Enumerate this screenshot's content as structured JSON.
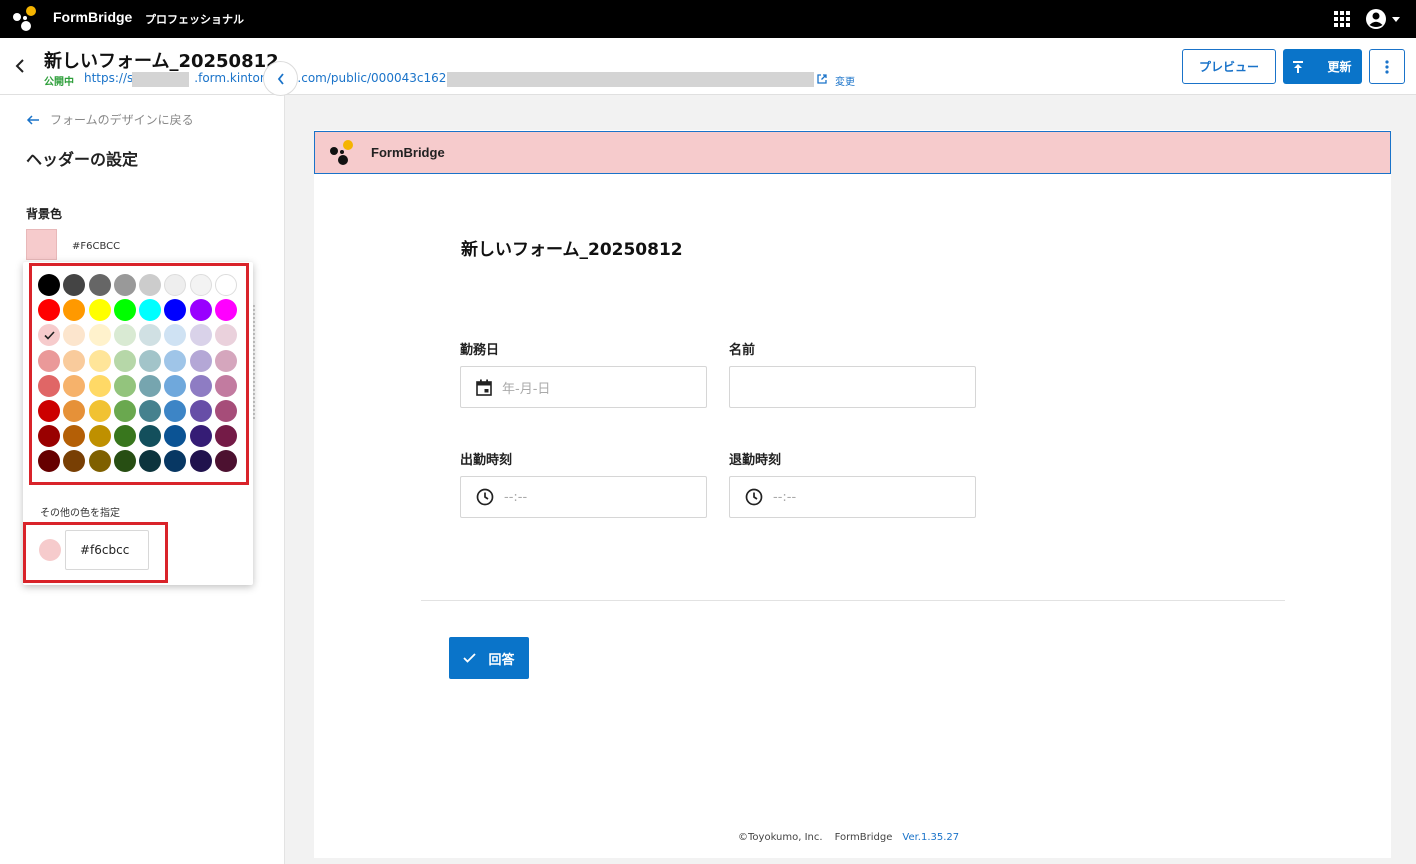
{
  "topbar": {
    "brand": "FormBridge",
    "edition": "プロフェッショナル"
  },
  "header": {
    "form_title": "新しいフォーム_20250812",
    "status": "公開中",
    "url": "https://s                .form.kintoneapp.com/public/000043c16204",
    "change_label": "変更",
    "preview_button": "プレビュー",
    "update_button": "更新"
  },
  "left_panel": {
    "back_link": "フォームのデザインに戻る",
    "title": "ヘッダーの設定",
    "bg_label": "背景色",
    "bg_hex": "#F6CBCC",
    "other_color_label": "その他の色を指定",
    "custom_color_value": "#f6cbcc",
    "selected_color": "#F6CBCC",
    "palette": [
      "#000000",
      "#444444",
      "#666666",
      "#999999",
      "#cccccc",
      "#eeeeee",
      "#f3f3f3",
      "#ffffff",
      "#ff0000",
      "#ff9900",
      "#ffff00",
      "#00ff00",
      "#00ffff",
      "#0000ff",
      "#9900ff",
      "#ff00ff",
      "#F6CBCC",
      "#fce5cd",
      "#fff2cc",
      "#d9ead3",
      "#d0e0e3",
      "#cfe2f3",
      "#d9d2e9",
      "#ead1dc",
      "#ea9999",
      "#f9cb9c",
      "#ffe599",
      "#b6d7a8",
      "#a2c4c9",
      "#9fc5e8",
      "#b4a7d6",
      "#d5a6bd",
      "#e06666",
      "#f6b26b",
      "#ffd966",
      "#93c47d",
      "#76a5af",
      "#6fa8dc",
      "#8e7cc3",
      "#c27ba0",
      "#cc0000",
      "#e69138",
      "#f1c232",
      "#6aa84f",
      "#45818e",
      "#3d85c6",
      "#674ea7",
      "#a64d79",
      "#990000",
      "#b45f06",
      "#bf9000",
      "#38761d",
      "#134f5c",
      "#0b5394",
      "#351c75",
      "#741b47",
      "#660000",
      "#783f04",
      "#7f6000",
      "#274e13",
      "#0c343d",
      "#073763",
      "#20124d",
      "#4c1130"
    ]
  },
  "preview": {
    "header_color": "#F6CBCC",
    "brand": "FormBridge",
    "form_title": "新しいフォーム_20250812",
    "fields": [
      {
        "label": "勤務日",
        "placeholder": "年-月-日",
        "icon": "calendar-icon"
      },
      {
        "label": "名前",
        "placeholder": "",
        "icon": ""
      },
      {
        "label": "出勤時刻",
        "placeholder": "--:--",
        "icon": "clock-icon"
      },
      {
        "label": "退勤時刻",
        "placeholder": "--:--",
        "icon": "clock-icon"
      }
    ],
    "submit_label": "回答",
    "footer": {
      "copyright": "©Toyokumo, Inc.",
      "brand": "FormBridge",
      "version": "Ver.1.35.27"
    }
  },
  "colors": {
    "accent": "#0a74c9",
    "highlight": "#d9232a",
    "topbar": "#000000"
  }
}
